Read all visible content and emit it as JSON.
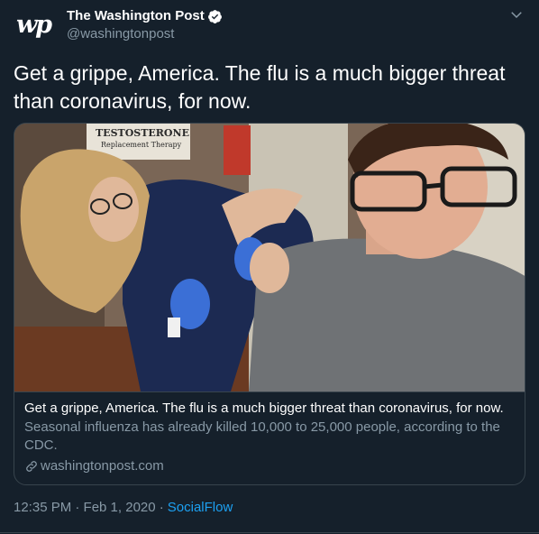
{
  "author": {
    "logo_text": "wp",
    "display_name": "The Washington Post",
    "handle": "@washingtonpost",
    "verified": true
  },
  "tweet": {
    "text": "Get a grippe, America. The flu is a much bigger threat than coronavirus, for now."
  },
  "card": {
    "image_alt": "Nurse administering flu shot to a teenage boy",
    "sign_text_1": "TESTOSTERONE",
    "sign_text_2": "Replacement Therapy",
    "title": "Get a grippe, America. The flu is a much bigger threat than coronavirus, for now.",
    "description": "Seasonal influenza has already killed 10,000 to 25,000 people, according to the CDC.",
    "domain": "washingtonpost.com"
  },
  "footer": {
    "timestamp": "12:35 PM · Feb 1, 2020 ·",
    "source": "SocialFlow"
  },
  "colors": {
    "background": "#15202b",
    "secondary_text": "#8899a6",
    "accent": "#1da1f2",
    "border": "#38444d"
  },
  "icons": [
    "verified-badge-icon",
    "chevron-down-icon",
    "link-icon"
  ]
}
